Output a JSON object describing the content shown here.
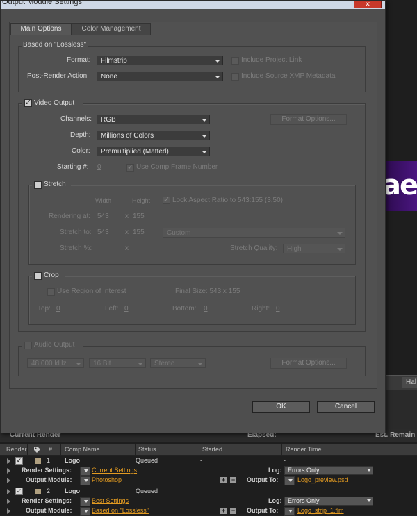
{
  "dialog": {
    "title": "Output Module Settings",
    "close_glyph": "✕",
    "tabs": [
      "Main Options",
      "Color Management"
    ],
    "based_on": "Based on \"Lossless\"",
    "format_label": "Format:",
    "format_value": "Filmstrip",
    "include_project_link": "Include Project Link",
    "post_render_label": "Post-Render Action:",
    "post_render_value": "None",
    "include_xmp": "Include Source XMP Metadata",
    "video_output": "Video Output",
    "channels_label": "Channels:",
    "channels_value": "RGB",
    "format_options": "Format Options...",
    "depth_label": "Depth:",
    "depth_value": "Millions of Colors",
    "color_label": "Color:",
    "color_value": "Premultiplied (Matted)",
    "starting_label": "Starting #:",
    "starting_value": "0",
    "use_comp_frame": "Use Comp Frame Number",
    "stretch": {
      "title": "Stretch",
      "width_hdr": "Width",
      "height_hdr": "Height",
      "lock_aspect": "Lock Aspect Ratio to 543:155 (3,50)",
      "rendering_at_label": "Rendering at:",
      "rendering_w": "543",
      "x": "x",
      "rendering_h": "155",
      "stretch_to_label": "Stretch to:",
      "stretch_w": "543",
      "stretch_h": "155",
      "preset": "Custom",
      "stretch_pct_label": "Stretch %:",
      "quality_label": "Stretch Quality:",
      "quality_value": "High"
    },
    "crop": {
      "title": "Crop",
      "use_roi": "Use Region of Interest",
      "final_size": "Final Size: 543 x 155",
      "top_label": "Top:",
      "top": "0",
      "left_label": "Left:",
      "left": "0",
      "bottom_label": "Bottom:",
      "bottom": "0",
      "right_label": "Right:",
      "right": "0"
    },
    "audio": {
      "title": "Audio Output",
      "rate": "48,000 kHz",
      "bits": "16 Bit",
      "channels": "Stereo",
      "format_options": "Format Options..."
    },
    "ok": "OK",
    "cancel": "Cancel"
  },
  "background": {
    "preview_text": "ae",
    "hal_button": "Hal",
    "queue_header": {
      "current_render": "Current Render",
      "elapsed": "Elapsed:",
      "est_remain": "Est. Remain"
    },
    "columns": [
      "Render",
      "#",
      "Comp Name",
      "Status",
      "Started",
      "Render Time"
    ],
    "items": [
      {
        "num": "1",
        "name": "Logo",
        "status": "Queued",
        "started": "-",
        "render_time": "-",
        "render_settings_label": "Render Settings:",
        "render_settings": "Current Settings",
        "log_label": "Log:",
        "log": "Errors Only",
        "output_module_label": "Output Module:",
        "output_module": "Photoshop",
        "output_to_label": "Output To:",
        "output_to": "Logo_preview.psd"
      },
      {
        "num": "2",
        "name": "Logo",
        "status": "Queued",
        "started": "",
        "render_time": "",
        "render_settings_label": "Render Settings:",
        "render_settings": "Best Settings",
        "log_label": "Log:",
        "log": "Errors Only",
        "output_module_label": "Output Module:",
        "output_module": "Based on \"Lossless\"",
        "output_to_label": "Output To:",
        "output_to": "Logo_strip_1.flm"
      }
    ]
  }
}
